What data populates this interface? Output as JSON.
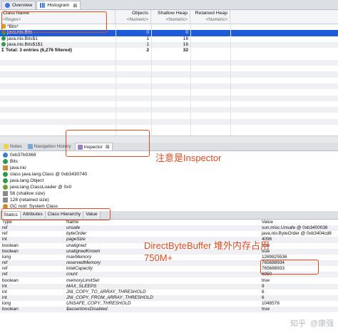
{
  "top_tabs": [
    {
      "label": "Overview",
      "icon": "info-icon",
      "active": false
    },
    {
      "label": "Histogram",
      "icon": "histogram-icon",
      "active": true,
      "close": "⊠"
    }
  ],
  "histogram": {
    "columns": [
      {
        "title": "Class Name",
        "filter": "<Regex>"
      },
      {
        "title": "Objects",
        "filter": "<Numeric>"
      },
      {
        "title": "Shallow Heap",
        "filter": "<Numeric>"
      },
      {
        "title": "Retained Heap",
        "filter": "<Numeric>"
      }
    ],
    "rows": [
      {
        "name": "*Bits*",
        "objects": "",
        "shallow": "",
        "retained": ""
      },
      {
        "name": "java.nio.Bits",
        "objects": "0",
        "shallow": "0",
        "retained": ""
      },
      {
        "name": "java.nio.Bits$1",
        "objects": "1",
        "shallow": "16",
        "retained": ""
      },
      {
        "name": "java.nio.Bits$1$1",
        "objects": "1",
        "shallow": "16",
        "retained": ""
      },
      {
        "name": "Total: 3 entries (6,276 filtered)",
        "objects": "2",
        "shallow": "32",
        "retained": ""
      }
    ]
  },
  "mid_tabs": [
    {
      "label": "Notes",
      "active": false
    },
    {
      "label": "Navigation History",
      "active": false
    },
    {
      "label": "Inspector",
      "active": true,
      "close": "⊠"
    }
  ],
  "inspector": {
    "rows": [
      {
        "icon": "object-icon",
        "text": "0xb37b0368"
      },
      {
        "icon": "class-icon",
        "text": "Bits"
      },
      {
        "icon": "package-icon",
        "text": "java.nio"
      },
      {
        "icon": "class-icon",
        "text": "class java.lang.Class @ 0xb3430740"
      },
      {
        "icon": "class-icon",
        "text": "java.lang.Object"
      },
      {
        "icon": "classloader-icon",
        "text": "java.lang.ClassLoader @ 0x0"
      },
      {
        "icon": "size-icon",
        "text": "56 (shallow size)"
      },
      {
        "icon": "size-icon",
        "text": "128 (retained size)"
      },
      {
        "icon": "gc-icon",
        "text": "GC root: System Class"
      }
    ]
  },
  "bottom_tabs": [
    {
      "label": "Statics",
      "active": true
    },
    {
      "label": "Attributes",
      "active": false
    },
    {
      "label": "Class Hierarchy",
      "active": false
    },
    {
      "label": "Value",
      "active": false
    }
  ],
  "statics": {
    "columns": [
      "Type",
      "Name",
      "Value"
    ],
    "rows": [
      {
        "type": "ref",
        "name": "unsafe",
        "value": "sun.misc.Unsafe @ 0xb3400038"
      },
      {
        "type": "ref",
        "name": "byteOrder",
        "value": "java.nio.ByteOrder @ 0xb3404cd8"
      },
      {
        "type": "int",
        "name": "pageSize",
        "value": "4096"
      },
      {
        "type": "boolean",
        "name": "unaligned",
        "value": "true"
      },
      {
        "type": "boolean",
        "name": "unalignedKnown",
        "value": "true"
      },
      {
        "type": "long",
        "name": "maxMemory",
        "value": "1269825536"
      },
      {
        "type": "ref",
        "name": "reservedMemory",
        "value": "765688934"
      },
      {
        "type": "ref",
        "name": "totalCapacity",
        "value": "765688933"
      },
      {
        "type": "ref",
        "name": "count",
        "value": "6950"
      },
      {
        "type": "boolean",
        "name": "memoryLimitSet",
        "value": "true"
      },
      {
        "type": "int",
        "name": "MAX_SLEEPS",
        "value": "9"
      },
      {
        "type": "int",
        "name": "JNI_COPY_TO_ARRAY_THRESHOLD",
        "value": "6"
      },
      {
        "type": "int",
        "name": "JNI_COPY_FROM_ARRAY_THRESHOLD",
        "value": "6"
      },
      {
        "type": "long",
        "name": "UNSAFE_COPY_THRESHOLD",
        "value": "1048576"
      },
      {
        "type": "boolean",
        "name": "$assertionsDisabled",
        "value": "true"
      }
    ]
  },
  "annotations": {
    "inspector_note": "注意是Inspector",
    "dbb_note_line1": "DirectByteBuffer 堆外内存占用",
    "dbb_note_line2": "750M+"
  },
  "watermark": {
    "site": "知乎",
    "author": "@康强"
  },
  "colors": {
    "selection": "#1f5bd9",
    "annotation": "#e04a1f"
  }
}
